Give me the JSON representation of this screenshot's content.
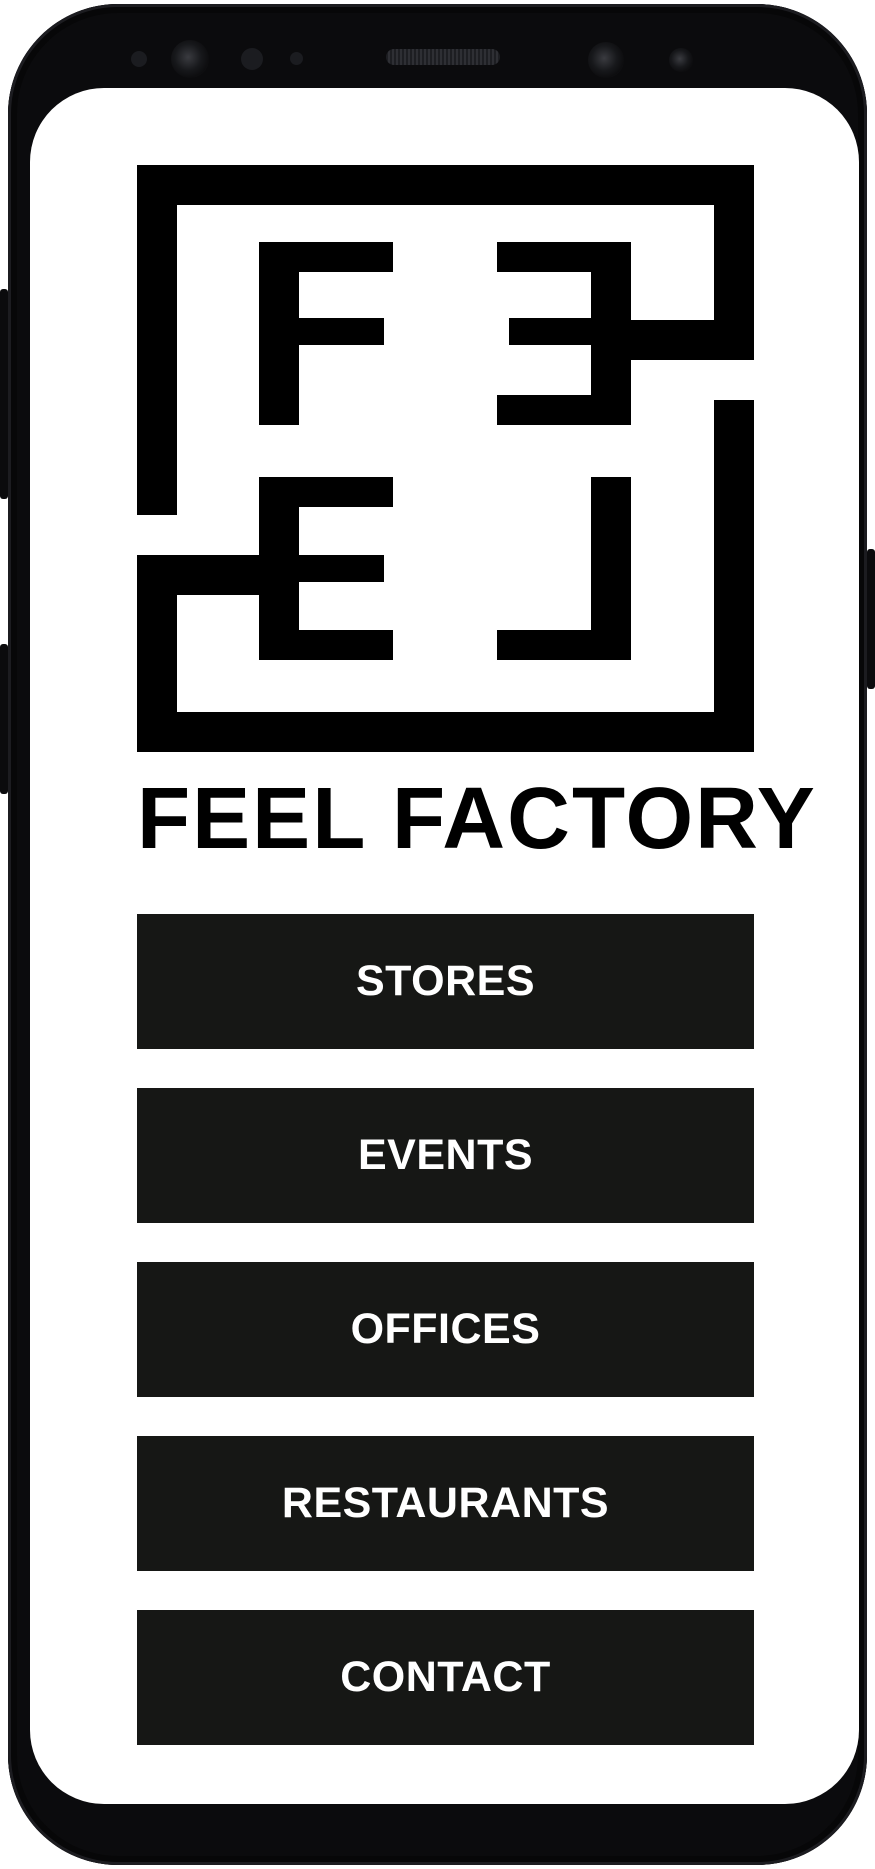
{
  "app": {
    "brand_name": "FEEL FACTORY",
    "logo_letters": [
      "F",
      "E",
      "E",
      "L"
    ]
  },
  "menu": {
    "items": [
      {
        "label": "STORES"
      },
      {
        "label": "EVENTS"
      },
      {
        "label": "OFFICES"
      },
      {
        "label": "RESTAURANTS"
      },
      {
        "label": "CONTACT"
      }
    ]
  },
  "colors": {
    "background": "#ffffff",
    "logo": "#000000",
    "button_background": "#161715",
    "button_text": "#ffffff",
    "device_frame": "#0b0b0d"
  }
}
